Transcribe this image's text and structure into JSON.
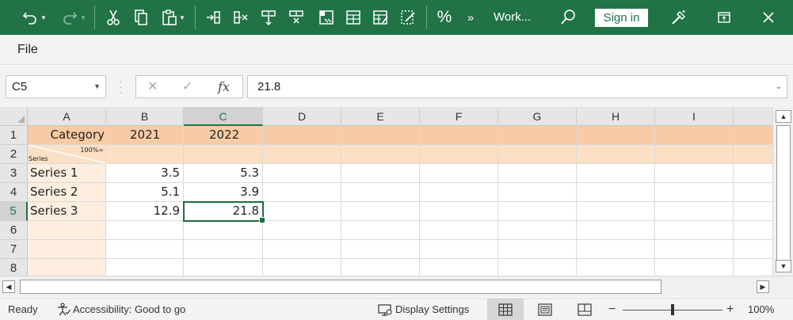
{
  "toolbar": {
    "undo_icon": "undo-icon",
    "redo_icon": "redo-icon",
    "workbook_name": "Work...",
    "sign_in_label": "Sign in",
    "percent_label": "%",
    "more_label": "»"
  },
  "menu": {
    "file_label": "File"
  },
  "formula_bar": {
    "name_box": "C5",
    "fx_label": "fx",
    "formula_value": "21.8"
  },
  "grid": {
    "columns": [
      "A",
      "B",
      "C",
      "D",
      "E",
      "F",
      "G",
      "H",
      "I"
    ],
    "rows": [
      "1",
      "2",
      "3",
      "4",
      "5",
      "6",
      "7",
      "8"
    ],
    "selected_cell": "C5",
    "header_row": {
      "category": "Category",
      "y2021": "2021",
      "y2022": "2022"
    },
    "row2": {
      "top_note": "100%=",
      "bottom_note": "Series"
    },
    "data": [
      {
        "label": "Series 1",
        "b": "3.5",
        "c": "5.3"
      },
      {
        "label": "Series 2",
        "b": "5.1",
        "c": "3.9"
      },
      {
        "label": "Series 3",
        "b": "12.9",
        "c": "21.8"
      }
    ]
  },
  "status_bar": {
    "ready": "Ready",
    "accessibility": "Accessibility: Good to go",
    "display_settings": "Display Settings",
    "zoom_minus": "−",
    "zoom_plus": "+",
    "zoom_level": "100%",
    "zoom_fraction": 0.5
  },
  "colors": {
    "excel_green": "#217346",
    "header_orange": "#f8cba4",
    "row_peach": "#fbe0c6",
    "column_a_peach": "#fdeee0"
  }
}
